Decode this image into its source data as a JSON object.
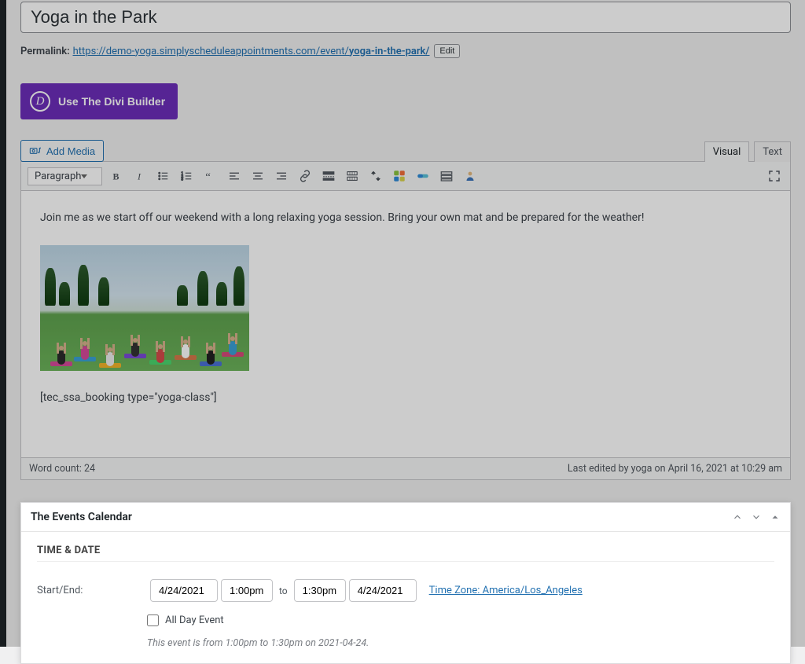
{
  "title": "Yoga in the Park",
  "permalink": {
    "label": "Permalink:",
    "base": "https://demo-yoga.simplyscheduleappointments.com/event/",
    "slug": "yoga-in-the-park/",
    "edit_label": "Edit"
  },
  "divi_button": "Use The Divi Builder",
  "add_media_label": "Add Media",
  "tabs": {
    "visual": "Visual",
    "text": "Text"
  },
  "format_dropdown": "Paragraph",
  "editor": {
    "paragraph": "Join me as we start off our weekend with a long relaxing yoga session. Bring your own mat and be prepared for the weather!",
    "shortcode": "[tec_ssa_booking type=\"yoga-class\"]"
  },
  "status_bar": {
    "word_count": "Word count: 24",
    "last_edited": "Last edited by yoga on April 16, 2021 at 10:29 am"
  },
  "events_panel": {
    "title": "The Events Calendar",
    "section": "TIME & DATE",
    "start_end_label": "Start/End:",
    "start_date": "4/24/2021",
    "start_time": "1:00pm",
    "to": "to",
    "end_time": "1:30pm",
    "end_date": "4/24/2021",
    "timezone": "Time Zone: America/Los_Angeles",
    "all_day_label": "All Day Event",
    "summary": "This event is from 1:00pm to 1:30pm on 2021-04-24."
  }
}
